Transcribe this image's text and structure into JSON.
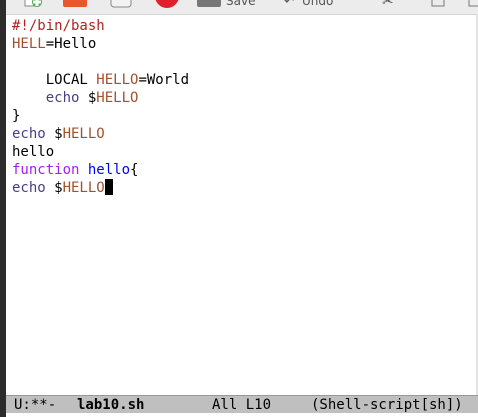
{
  "buffer": {
    "lines": [
      [
        {
          "text": "#!/bin/bash",
          "cls": "c-comment"
        }
      ],
      [
        {
          "text": "HELL",
          "cls": "c-var"
        },
        {
          "text": "=Hello",
          "cls": ""
        }
      ],
      [
        {
          "text": "",
          "cls": ""
        }
      ],
      [
        {
          "text": "    LOCAL ",
          "cls": ""
        },
        {
          "text": "HELLO",
          "cls": "c-var"
        },
        {
          "text": "=World",
          "cls": ""
        }
      ],
      [
        {
          "text": "    ",
          "cls": ""
        },
        {
          "text": "echo",
          "cls": "c-builtin"
        },
        {
          "text": " $",
          "cls": ""
        },
        {
          "text": "HELLO",
          "cls": "c-var"
        }
      ],
      [
        {
          "text": "}",
          "cls": ""
        }
      ],
      [
        {
          "text": "echo",
          "cls": "c-builtin"
        },
        {
          "text": " $",
          "cls": ""
        },
        {
          "text": "HELLO",
          "cls": "c-var"
        }
      ],
      [
        {
          "text": "hello",
          "cls": ""
        }
      ],
      [
        {
          "text": "function",
          "cls": "c-kw"
        },
        {
          "text": " ",
          "cls": ""
        },
        {
          "text": "hello",
          "cls": "c-fn"
        },
        {
          "text": "{",
          "cls": ""
        }
      ],
      [
        {
          "text": "echo",
          "cls": "c-builtin"
        },
        {
          "text": " $",
          "cls": ""
        },
        {
          "text": "HELLO",
          "cls": "c-var"
        }
      ]
    ]
  },
  "toolbar": {
    "save_label": "Save",
    "undo_label": "Undo"
  },
  "modeline": {
    "status": "U:**-",
    "filename": "lab10.sh",
    "position": "All L10",
    "mode": "(Shell-script[sh])"
  },
  "colors": {
    "comment": "#b22222",
    "variable": "#a0522d",
    "keyword": "#a020f0",
    "function_name": "#0000ff",
    "builtin": "#483d8b",
    "modeline_bg": "#bfbfbf"
  }
}
